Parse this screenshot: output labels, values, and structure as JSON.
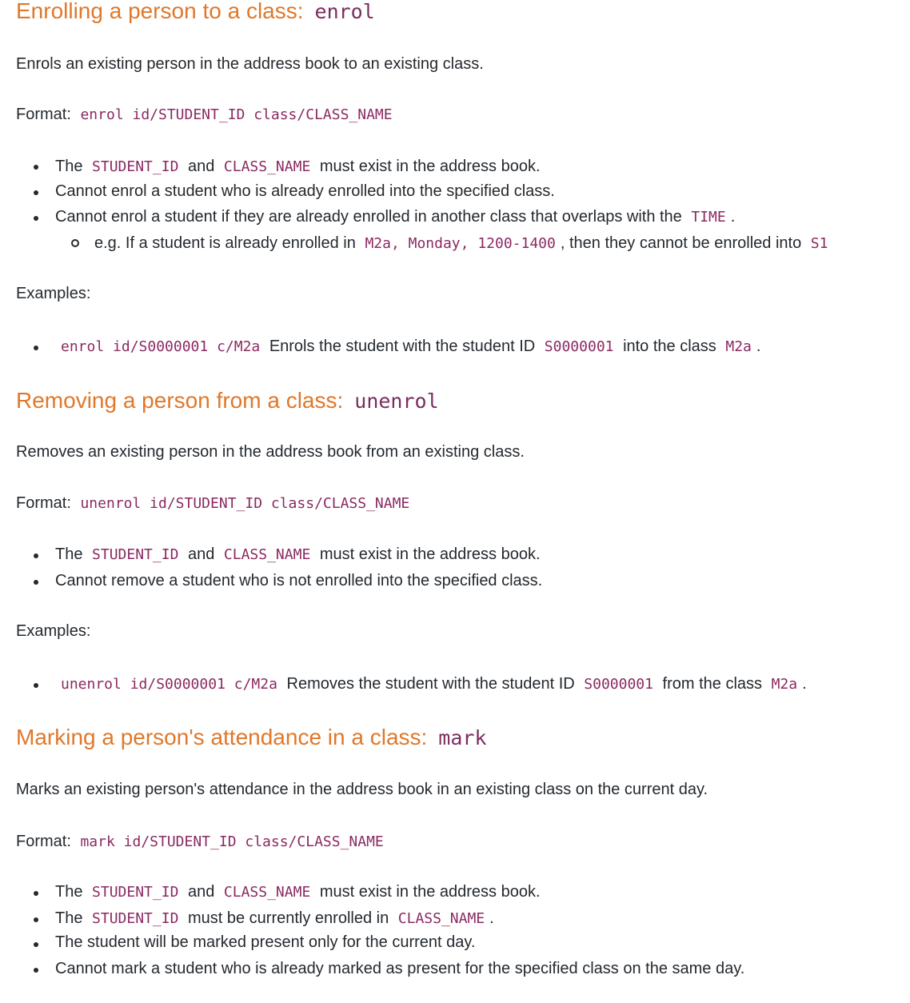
{
  "enrol": {
    "heading": "Enrolling a person to a class:",
    "command": "enrol",
    "description": "Enrols an existing person in the address book to an existing class.",
    "format_label": "Format:",
    "format": "enrol id/STUDENT_ID class/CLASS_NAME",
    "bullets": [
      {
        "pre": "The",
        "code1": "STUDENT_ID",
        "mid": "and",
        "code2": "CLASS_NAME",
        "post": "must exist in the address book."
      },
      {
        "text": "Cannot enrol a student who is already enrolled into the specified class."
      },
      {
        "pre": "Cannot enrol a student if they are already enrolled in another class that overlaps with the",
        "code": "TIME",
        "post": "."
      }
    ],
    "sub_bullet": {
      "pre": "e.g. If a student is already enrolled in",
      "code": "M2a, Monday, 1200-1400",
      "post": ", then they cannot be enrolled into",
      "code2": "S1"
    },
    "examples_label": "Examples:",
    "example": {
      "code": "enrol id/S0000001 c/M2a",
      "pre": "Enrols the student with the student ID",
      "code2": "S0000001",
      "mid": "into the class",
      "code3": "M2a",
      "post": "."
    }
  },
  "unenrol": {
    "heading": "Removing a person from a class:",
    "command": "unenrol",
    "description": "Removes an existing person in the address book from an existing class.",
    "format_label": "Format:",
    "format": "unenrol id/STUDENT_ID class/CLASS_NAME",
    "bullets": [
      {
        "pre": "The",
        "code1": "STUDENT_ID",
        "mid": "and",
        "code2": "CLASS_NAME",
        "post": "must exist in the address book."
      },
      {
        "text": "Cannot remove a student who is not enrolled into the specified class."
      }
    ],
    "examples_label": "Examples:",
    "example": {
      "code": "unenrol id/S0000001 c/M2a",
      "pre": "Removes the student with the student ID",
      "code2": "S0000001",
      "mid": "from the class",
      "code3": "M2a",
      "post": "."
    }
  },
  "mark": {
    "heading": "Marking a person's attendance in a class:",
    "command": "mark",
    "description": "Marks an existing person's attendance in the address book in an existing class on the current day.",
    "format_label": "Format:",
    "format": "mark id/STUDENT_ID class/CLASS_NAME",
    "bullets": [
      {
        "pre": "The",
        "code1": "STUDENT_ID",
        "mid": "and",
        "code2": "CLASS_NAME",
        "post": "must exist in the address book."
      },
      {
        "pre": "The",
        "code": "STUDENT_ID",
        "mid": "must be currently enrolled in",
        "code2": "CLASS_NAME",
        "post": "."
      },
      {
        "text": "The student will be marked present only for the current day."
      },
      {
        "text": "Cannot mark a student who is already marked as present for the specified class on the same day."
      }
    ]
  }
}
